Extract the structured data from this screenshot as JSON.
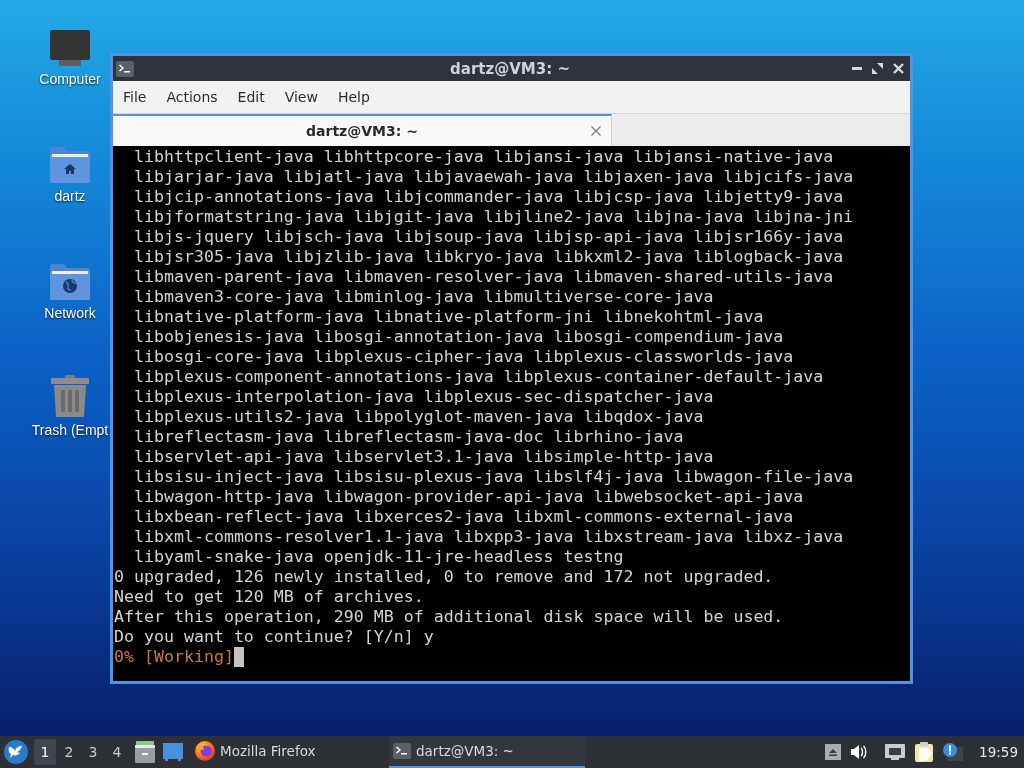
{
  "desktop_icons": [
    {
      "label": "Computer",
      "kind": "computer"
    },
    {
      "label": "dartz",
      "kind": "home-folder"
    },
    {
      "label": "Network",
      "kind": "network-folder"
    },
    {
      "label": "Trash (Empt",
      "kind": "trash"
    }
  ],
  "window": {
    "title": "dartz@VM3: ~",
    "menu": [
      "File",
      "Actions",
      "Edit",
      "View",
      "Help"
    ],
    "tabs": [
      {
        "label": "dartz@VM3: ~",
        "selected": true
      }
    ]
  },
  "terminal": {
    "lines": [
      {
        "kind": "output",
        "text": "  libhttpclient-java libhttpcore-java libjansi-java libjansi-native-java"
      },
      {
        "kind": "output",
        "text": "  libjarjar-java libjatl-java libjavaewah-java libjaxen-java libjcifs-java"
      },
      {
        "kind": "output",
        "text": "  libjcip-annotations-java libjcommander-java libjcsp-java libjetty9-java"
      },
      {
        "kind": "output",
        "text": "  libjformatstring-java libjgit-java libjline2-java libjna-java libjna-jni"
      },
      {
        "kind": "output",
        "text": "  libjs-jquery libjsch-java libjsoup-java libjsp-api-java libjsr166y-java"
      },
      {
        "kind": "output",
        "text": "  libjsr305-java libjzlib-java libkryo-java libkxml2-java liblogback-java"
      },
      {
        "kind": "output",
        "text": "  libmaven-parent-java libmaven-resolver-java libmaven-shared-utils-java"
      },
      {
        "kind": "output",
        "text": "  libmaven3-core-java libminlog-java libmultiverse-core-java"
      },
      {
        "kind": "output",
        "text": "  libnative-platform-java libnative-platform-jni libnekohtml-java"
      },
      {
        "kind": "output",
        "text": "  libobjenesis-java libosgi-annotation-java libosgi-compendium-java"
      },
      {
        "kind": "output",
        "text": "  libosgi-core-java libplexus-cipher-java libplexus-classworlds-java"
      },
      {
        "kind": "output",
        "text": "  libplexus-component-annotations-java libplexus-container-default-java"
      },
      {
        "kind": "output",
        "text": "  libplexus-interpolation-java libplexus-sec-dispatcher-java"
      },
      {
        "kind": "output",
        "text": "  libplexus-utils2-java libpolyglot-maven-java libqdox-java"
      },
      {
        "kind": "output",
        "text": "  libreflectasm-java libreflectasm-java-doc librhino-java"
      },
      {
        "kind": "output",
        "text": "  libservlet-api-java libservlet3.1-java libsimple-http-java"
      },
      {
        "kind": "output",
        "text": "  libsisu-inject-java libsisu-plexus-java libslf4j-java libwagon-file-java"
      },
      {
        "kind": "output",
        "text": "  libwagon-http-java libwagon-provider-api-java libwebsocket-api-java"
      },
      {
        "kind": "output",
        "text": "  libxbean-reflect-java libxerces2-java libxml-commons-external-java"
      },
      {
        "kind": "output",
        "text": "  libxml-commons-resolver1.1-java libxpp3-java libxstream-java libxz-java"
      },
      {
        "kind": "output",
        "text": "  libyaml-snake-java openjdk-11-jre-headless testng"
      },
      {
        "kind": "output",
        "text": "0 upgraded, 126 newly installed, 0 to remove and 172 not upgraded."
      },
      {
        "kind": "output",
        "text": "Need to get 120 MB of archives."
      },
      {
        "kind": "output",
        "text": "After this operation, 290 MB of additional disk space will be used."
      },
      {
        "kind": "output",
        "text": "Do you want to continue? [Y/n] y"
      },
      {
        "kind": "status",
        "text": "0% [Working]"
      }
    ]
  },
  "taskbar": {
    "workspaces": [
      {
        "label": "1",
        "selected": true
      },
      {
        "label": "2",
        "selected": false
      },
      {
        "label": "3",
        "selected": false
      },
      {
        "label": "4",
        "selected": false
      }
    ],
    "tasks": [
      {
        "label": "Mozilla Firefox",
        "kind": "browser",
        "selected": false
      },
      {
        "label": "dartz@VM3: ~",
        "kind": "terminal",
        "selected": true
      }
    ],
    "clock": "19:59"
  }
}
